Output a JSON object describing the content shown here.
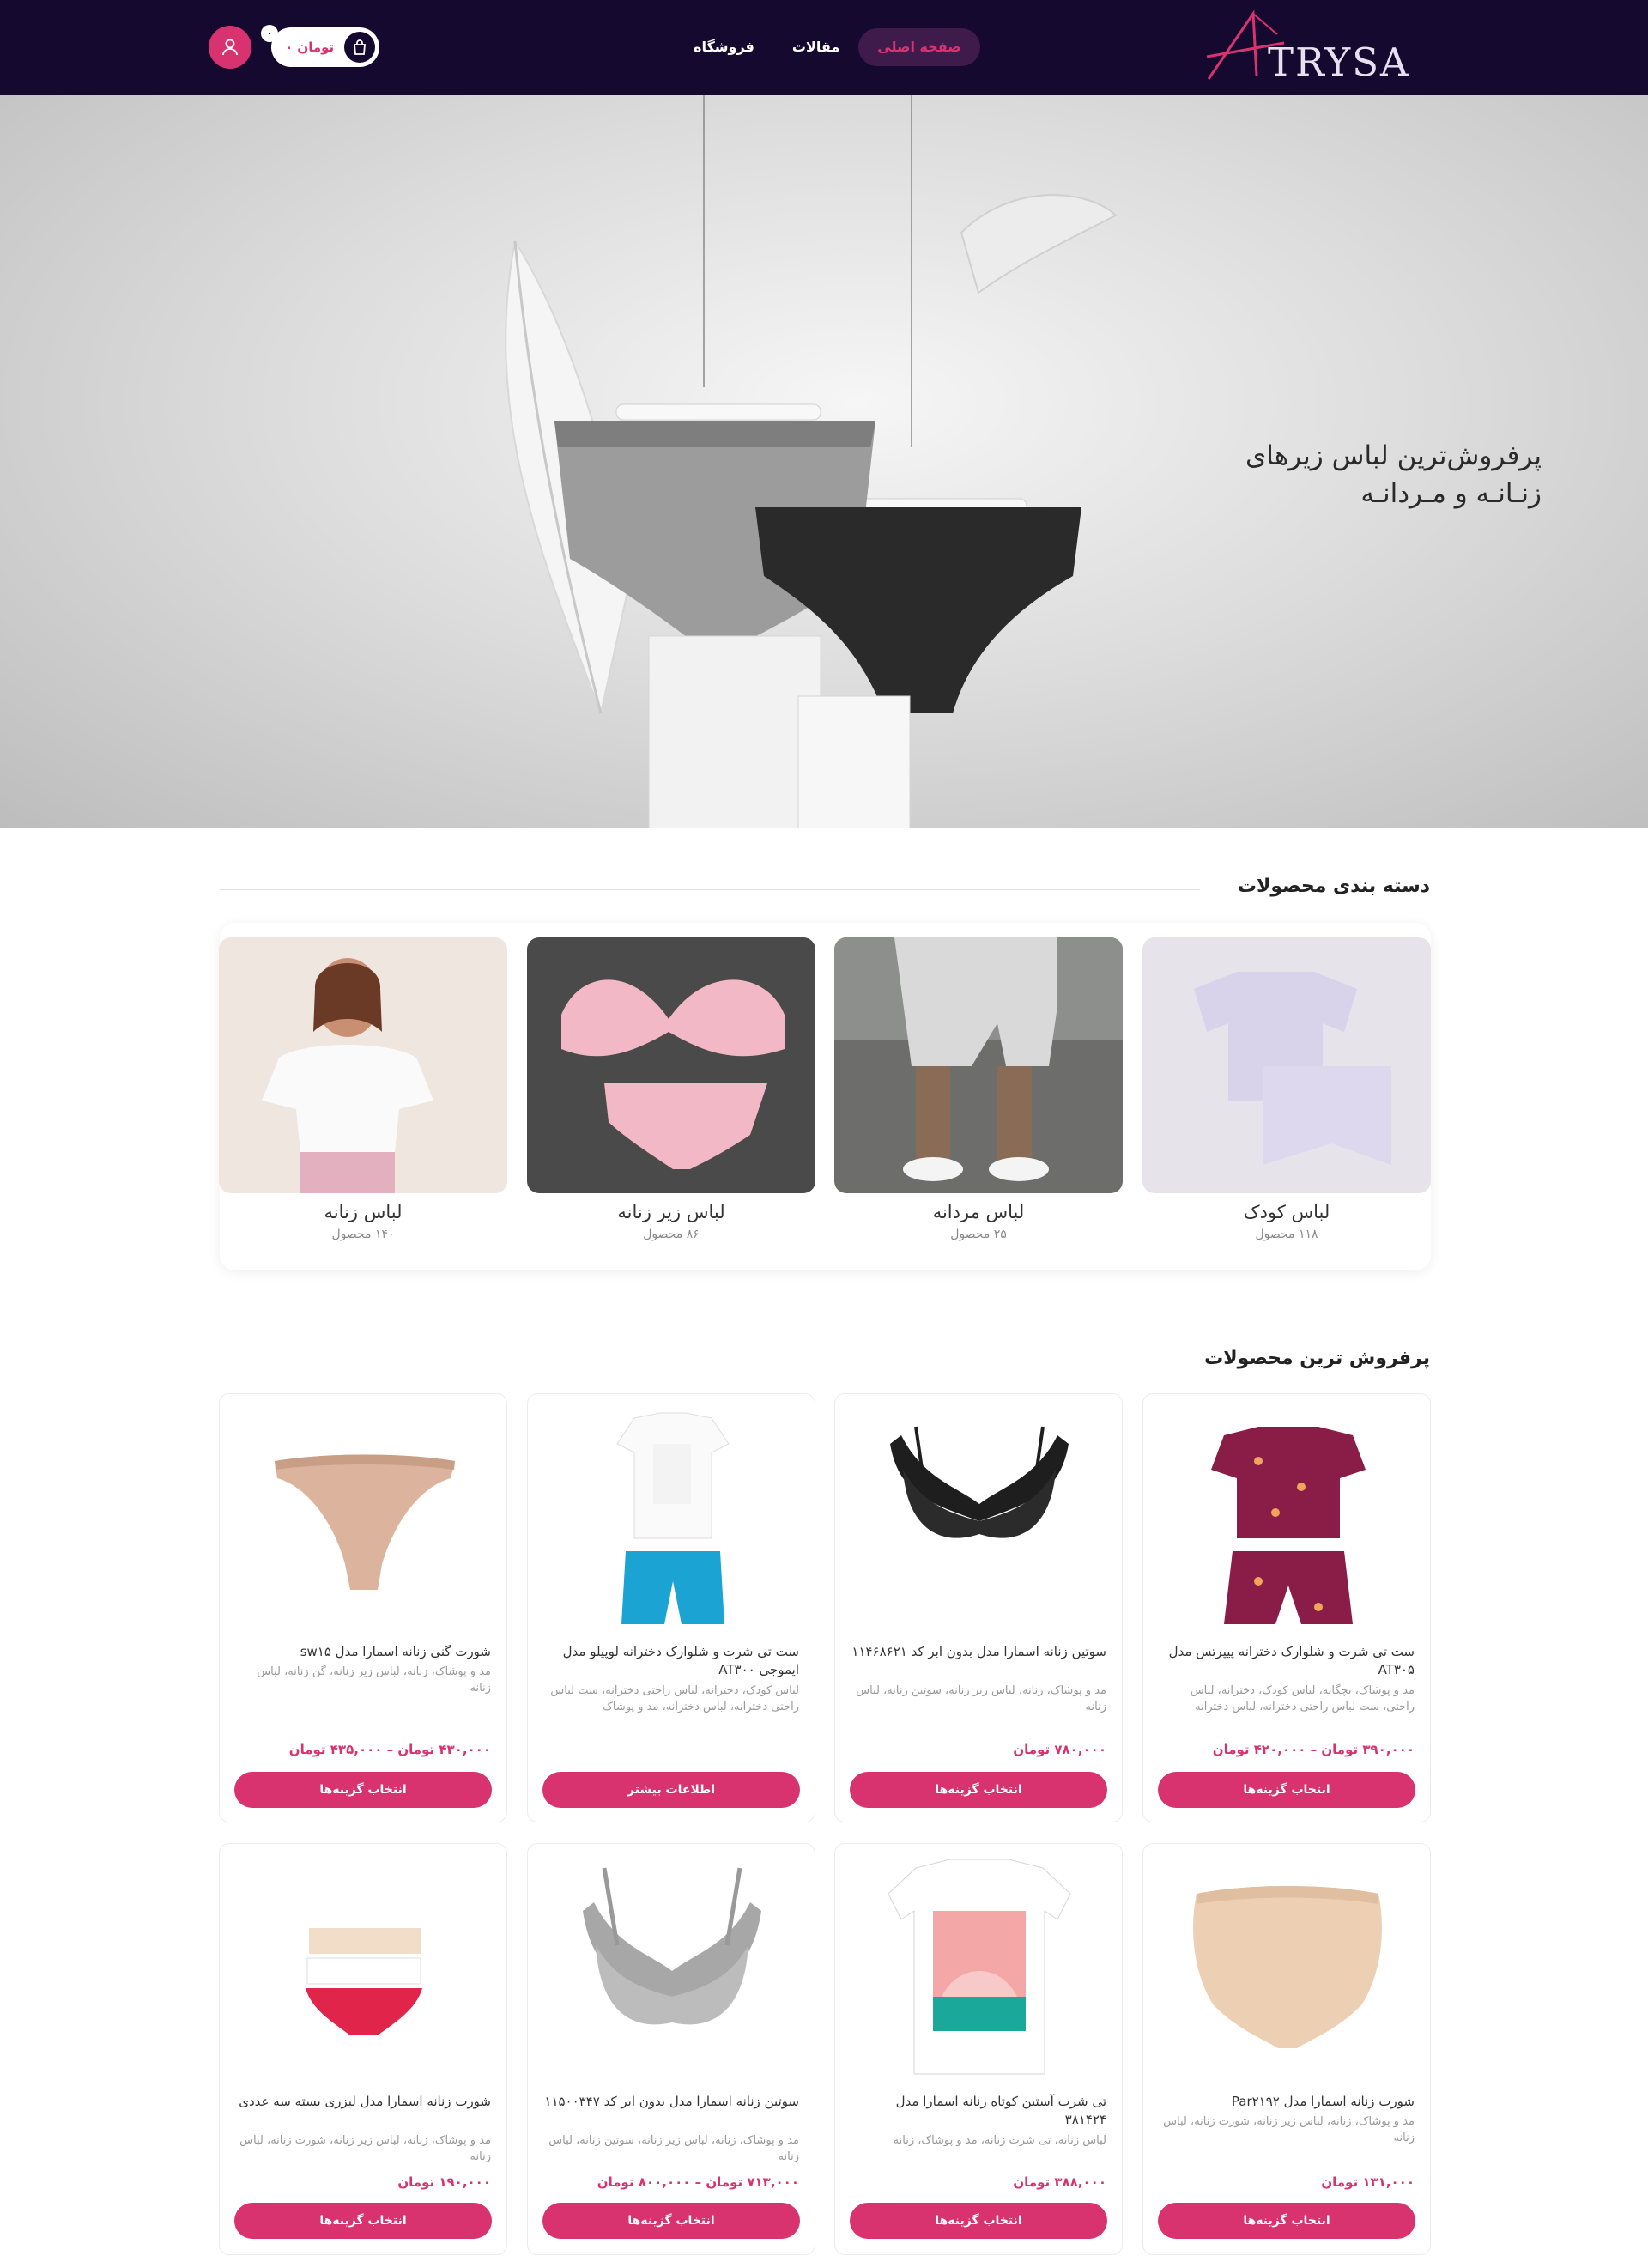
{
  "header": {
    "logo_text": "TRYSA",
    "nav": [
      "صفحه اصلی",
      "مقالات",
      "فروشگاه"
    ],
    "cart_total": "۰ تومان",
    "cart_count": "۰"
  },
  "hero": {
    "title_line1": "پرفروش‌ترین لباس زیرهای",
    "title_line2": "زنـانـه و مـردانـه"
  },
  "categories": {
    "title": "دسته بندی محصولات",
    "items": [
      {
        "name": "لباس کودک",
        "count": "۱۱۸ محصول"
      },
      {
        "name": "لباس مردانه",
        "count": "۲۵ محصول"
      },
      {
        "name": "لباس زیر زنانه",
        "count": "۸۶ محصول"
      },
      {
        "name": "لباس زنانه",
        "count": "۱۴۰ محصول"
      }
    ]
  },
  "products": {
    "title": "پرفروش ترین محصولات",
    "items": [
      {
        "title": "ست تی شرت و شلوارک دخترانه پیپرتس مدل AT۳۰۵",
        "cats": "مد و پوشاک، بچگانه، لباس کودک، دخترانه، لباس راحتی، ست لباس راحتی دخترانه، لباس دخترانه",
        "price": "۳۹۰,۰۰۰ تومان – ۴۲۰,۰۰۰ تومان",
        "button": "انتخاب گزینه‌ها"
      },
      {
        "title": "سوتین زنانه اسمارا مدل بدون ابر کد ۱۱۴۶۸۶۲۱",
        "cats": "مد و پوشاک، زنانه، لباس زیر زنانه، سوتین زنانه، لباس زنانه",
        "price": "۷۸۰,۰۰۰ تومان",
        "button": "انتخاب گزینه‌ها"
      },
      {
        "title": "ست تی شرت و شلوارک دخترانه لوپیلو مدل ایموجی AT۳۰۰",
        "cats": "لباس کودک، دخترانه، لباس راحتی دخترانه، ست لباس راحتی دخترانه، لباس دخترانه، مد و پوشاک",
        "price": "",
        "button": "اطلاعات بیشتر"
      },
      {
        "title": "شورت گنی زنانه اسمارا مدل sw۱۵",
        "cats": "مد و پوشاک، زنانه، لباس زیر زنانه، گن زنانه، لباس زنانه",
        "price": "۴۳۰,۰۰۰ تومان – ۴۳۵,۰۰۰ تومان",
        "button": "انتخاب گزینه‌ها"
      },
      {
        "title": "شورت زنانه اسمارا مدل Par۲۱۹۲",
        "cats": "مد و پوشاک، زنانه، لباس زیر زنانه، شورت زنانه، لباس زنانه",
        "price": "۱۳۱,۰۰۰ تومان",
        "button": "انتخاب گزینه‌ها"
      },
      {
        "title": "تی شرت آستین کوتاه زنانه اسمارا مدل ۳۸۱۴۲۴",
        "cats": "لباس زنانه، تی شرت زنانه، مد و پوشاک، زنانه",
        "price": "۳۸۸,۰۰۰ تومان",
        "button": "انتخاب گزینه‌ها"
      },
      {
        "title": "سوتین زنانه اسمارا مدل بدون ابر کد ۱۱۵۰۰۳۴۷",
        "cats": "مد و پوشاک، زنانه، لباس زیر زنانه، سوتین زنانه، لباس زنانه",
        "price": "۷۱۳,۰۰۰ تومان – ۸۰۰,۰۰۰ تومان",
        "button": "انتخاب گزینه‌ها"
      },
      {
        "title": "شورت زنانه اسمارا مدل لیزری بسته سه عددی",
        "cats": "مد و پوشاک، زنانه، لباس زیر زنانه، شورت زنانه، لباس زنانه",
        "price": "۱۹۰,۰۰۰ تومان",
        "button": "انتخاب گزینه‌ها"
      }
    ]
  }
}
